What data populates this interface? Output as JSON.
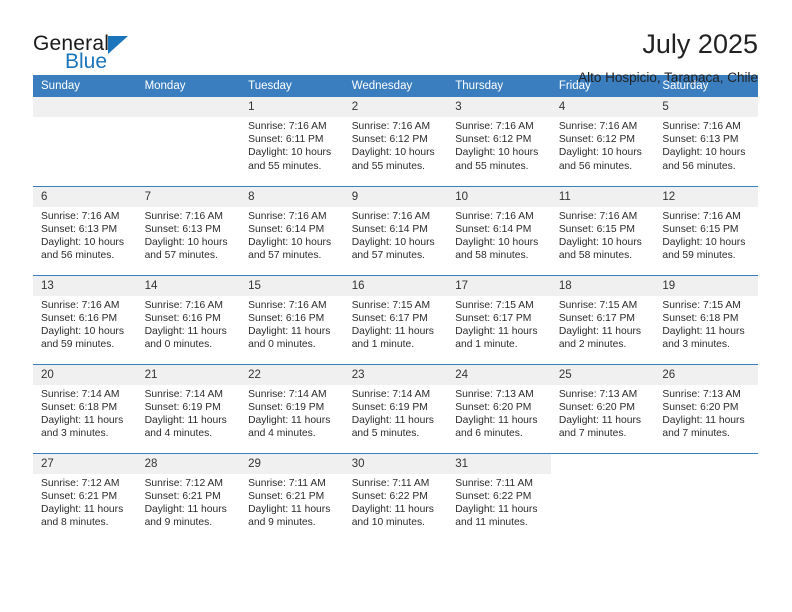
{
  "brand": {
    "name_top": "General",
    "name_bottom": "Blue",
    "accent_color": "#1b75bb"
  },
  "header": {
    "title": "July 2025",
    "subtitle": "Alto Hospicio, Tarapaca, Chile"
  },
  "calendar": {
    "header_bg": "#3a7ebf",
    "daynum_bg": "#f0f0f0",
    "weekdays": [
      "Sunday",
      "Monday",
      "Tuesday",
      "Wednesday",
      "Thursday",
      "Friday",
      "Saturday"
    ],
    "weeks": [
      [
        {
          "day": "",
          "lines": []
        },
        {
          "day": "",
          "lines": []
        },
        {
          "day": "1",
          "lines": [
            "Sunrise: 7:16 AM",
            "Sunset: 6:11 PM",
            "Daylight: 10 hours",
            "and 55 minutes."
          ]
        },
        {
          "day": "2",
          "lines": [
            "Sunrise: 7:16 AM",
            "Sunset: 6:12 PM",
            "Daylight: 10 hours",
            "and 55 minutes."
          ]
        },
        {
          "day": "3",
          "lines": [
            "Sunrise: 7:16 AM",
            "Sunset: 6:12 PM",
            "Daylight: 10 hours",
            "and 55 minutes."
          ]
        },
        {
          "day": "4",
          "lines": [
            "Sunrise: 7:16 AM",
            "Sunset: 6:12 PM",
            "Daylight: 10 hours",
            "and 56 minutes."
          ]
        },
        {
          "day": "5",
          "lines": [
            "Sunrise: 7:16 AM",
            "Sunset: 6:13 PM",
            "Daylight: 10 hours",
            "and 56 minutes."
          ]
        }
      ],
      [
        {
          "day": "6",
          "lines": [
            "Sunrise: 7:16 AM",
            "Sunset: 6:13 PM",
            "Daylight: 10 hours",
            "and 56 minutes."
          ]
        },
        {
          "day": "7",
          "lines": [
            "Sunrise: 7:16 AM",
            "Sunset: 6:13 PM",
            "Daylight: 10 hours",
            "and 57 minutes."
          ]
        },
        {
          "day": "8",
          "lines": [
            "Sunrise: 7:16 AM",
            "Sunset: 6:14 PM",
            "Daylight: 10 hours",
            "and 57 minutes."
          ]
        },
        {
          "day": "9",
          "lines": [
            "Sunrise: 7:16 AM",
            "Sunset: 6:14 PM",
            "Daylight: 10 hours",
            "and 57 minutes."
          ]
        },
        {
          "day": "10",
          "lines": [
            "Sunrise: 7:16 AM",
            "Sunset: 6:14 PM",
            "Daylight: 10 hours",
            "and 58 minutes."
          ]
        },
        {
          "day": "11",
          "lines": [
            "Sunrise: 7:16 AM",
            "Sunset: 6:15 PM",
            "Daylight: 10 hours",
            "and 58 minutes."
          ]
        },
        {
          "day": "12",
          "lines": [
            "Sunrise: 7:16 AM",
            "Sunset: 6:15 PM",
            "Daylight: 10 hours",
            "and 59 minutes."
          ]
        }
      ],
      [
        {
          "day": "13",
          "lines": [
            "Sunrise: 7:16 AM",
            "Sunset: 6:16 PM",
            "Daylight: 10 hours",
            "and 59 minutes."
          ]
        },
        {
          "day": "14",
          "lines": [
            "Sunrise: 7:16 AM",
            "Sunset: 6:16 PM",
            "Daylight: 11 hours",
            "and 0 minutes."
          ]
        },
        {
          "day": "15",
          "lines": [
            "Sunrise: 7:16 AM",
            "Sunset: 6:16 PM",
            "Daylight: 11 hours",
            "and 0 minutes."
          ]
        },
        {
          "day": "16",
          "lines": [
            "Sunrise: 7:15 AM",
            "Sunset: 6:17 PM",
            "Daylight: 11 hours",
            "and 1 minute."
          ]
        },
        {
          "day": "17",
          "lines": [
            "Sunrise: 7:15 AM",
            "Sunset: 6:17 PM",
            "Daylight: 11 hours",
            "and 1 minute."
          ]
        },
        {
          "day": "18",
          "lines": [
            "Sunrise: 7:15 AM",
            "Sunset: 6:17 PM",
            "Daylight: 11 hours",
            "and 2 minutes."
          ]
        },
        {
          "day": "19",
          "lines": [
            "Sunrise: 7:15 AM",
            "Sunset: 6:18 PM",
            "Daylight: 11 hours",
            "and 3 minutes."
          ]
        }
      ],
      [
        {
          "day": "20",
          "lines": [
            "Sunrise: 7:14 AM",
            "Sunset: 6:18 PM",
            "Daylight: 11 hours",
            "and 3 minutes."
          ]
        },
        {
          "day": "21",
          "lines": [
            "Sunrise: 7:14 AM",
            "Sunset: 6:19 PM",
            "Daylight: 11 hours",
            "and 4 minutes."
          ]
        },
        {
          "day": "22",
          "lines": [
            "Sunrise: 7:14 AM",
            "Sunset: 6:19 PM",
            "Daylight: 11 hours",
            "and 4 minutes."
          ]
        },
        {
          "day": "23",
          "lines": [
            "Sunrise: 7:14 AM",
            "Sunset: 6:19 PM",
            "Daylight: 11 hours",
            "and 5 minutes."
          ]
        },
        {
          "day": "24",
          "lines": [
            "Sunrise: 7:13 AM",
            "Sunset: 6:20 PM",
            "Daylight: 11 hours",
            "and 6 minutes."
          ]
        },
        {
          "day": "25",
          "lines": [
            "Sunrise: 7:13 AM",
            "Sunset: 6:20 PM",
            "Daylight: 11 hours",
            "and 7 minutes."
          ]
        },
        {
          "day": "26",
          "lines": [
            "Sunrise: 7:13 AM",
            "Sunset: 6:20 PM",
            "Daylight: 11 hours",
            "and 7 minutes."
          ]
        }
      ],
      [
        {
          "day": "27",
          "lines": [
            "Sunrise: 7:12 AM",
            "Sunset: 6:21 PM",
            "Daylight: 11 hours",
            "and 8 minutes."
          ]
        },
        {
          "day": "28",
          "lines": [
            "Sunrise: 7:12 AM",
            "Sunset: 6:21 PM",
            "Daylight: 11 hours",
            "and 9 minutes."
          ]
        },
        {
          "day": "29",
          "lines": [
            "Sunrise: 7:11 AM",
            "Sunset: 6:21 PM",
            "Daylight: 11 hours",
            "and 9 minutes."
          ]
        },
        {
          "day": "30",
          "lines": [
            "Sunrise: 7:11 AM",
            "Sunset: 6:22 PM",
            "Daylight: 11 hours",
            "and 10 minutes."
          ]
        },
        {
          "day": "31",
          "lines": [
            "Sunrise: 7:11 AM",
            "Sunset: 6:22 PM",
            "Daylight: 11 hours",
            "and 11 minutes."
          ]
        },
        {
          "day": "",
          "lines": []
        },
        {
          "day": "",
          "lines": []
        }
      ]
    ]
  }
}
